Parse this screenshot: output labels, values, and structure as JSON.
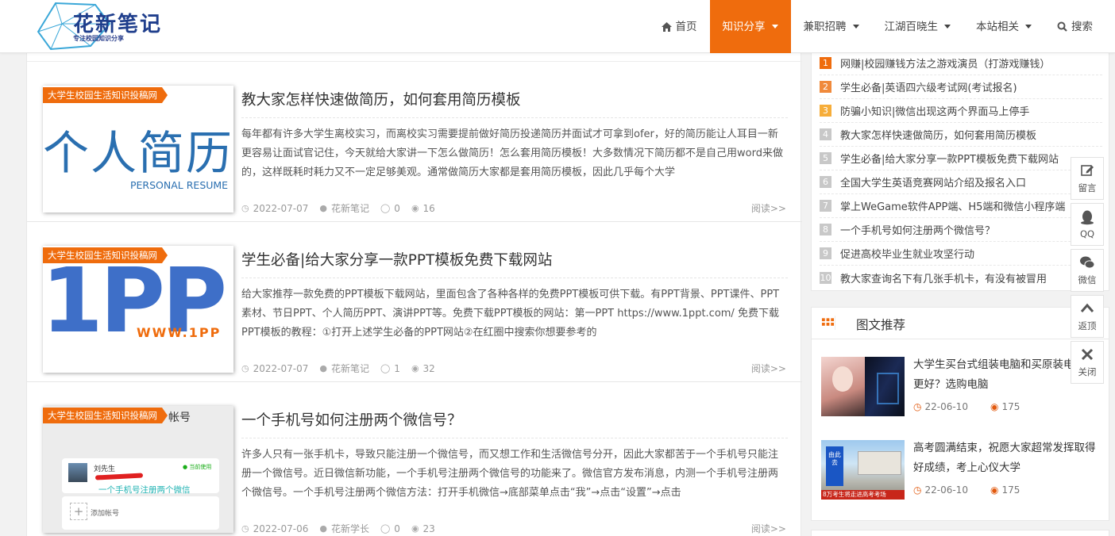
{
  "site": {
    "logo_title": "花新笔记",
    "logo_subtitle": "专注校园知识分享"
  },
  "nav": [
    {
      "label": "首页",
      "icon": "home-icon",
      "active": false,
      "dropdown": false
    },
    {
      "label": "知识分享",
      "icon": "",
      "active": true,
      "dropdown": true
    },
    {
      "label": "兼职招聘",
      "icon": "",
      "active": false,
      "dropdown": true
    },
    {
      "label": "江湖百晓生",
      "icon": "",
      "active": false,
      "dropdown": true
    },
    {
      "label": "本站相关",
      "icon": "",
      "active": false,
      "dropdown": true
    },
    {
      "label": "搜索",
      "icon": "search-icon",
      "active": false,
      "dropdown": false
    }
  ],
  "posts": [
    {
      "category_tag": "大学生校园生活知识投稿网",
      "title": "教大家怎样快速做简历，如何套用简历模板",
      "excerpt": "每年都有许多大学生离校实习，而离校实习需要提前做好简历投递简历并面试才可拿到ofer，好的简历能让人耳目一新更容易让面试官记住，今天就给大家讲一下怎么做简历！怎么套用简历模板！大多数情况下简历都不是自己用word来做的，这样既耗时耗力又不一定足够美观。通常做简历大家都是套用简历模板，因此几乎每个大学",
      "date": "2022-07-07",
      "author": "花新笔记",
      "comments": "0",
      "views": "16",
      "read_more": "阅读>>",
      "thumb_main": "个人简历",
      "thumb_sub": "PERSONAL RESUME"
    },
    {
      "category_tag": "大学生校园生活知识投稿网",
      "title": "学生必备|给大家分享一款PPT模板免费下载网站",
      "excerpt": "给大家推荐一款免费的PPT模板下载网站，里面包含了各种各样的免费PPT模板可供下载。有PPT背景、PPT课件、PPT素材、节日PPT、个人简历PPT、演讲PPT等。免费下载PPT模板的网站：第一PPT https://www.1ppt.com/ 免费下载PPT模板的教程：①打开上述学生必备的PPT网站②在红圈中搜索你想要参考的",
      "date": "2022-07-07",
      "author": "花新笔记",
      "comments": "1",
      "views": "32",
      "read_more": "阅读>>",
      "thumb_main": "1PP",
      "thumb_sub": "WWW.1PP"
    },
    {
      "category_tag": "大学生校园生活知识投稿网",
      "title": "一个手机号如何注册两个微信号？",
      "excerpt": "许多人只有一张手机卡，导致只能注册一个微信号，而又想工作和生活微信号分开，因此大家都苦于一个手机号只能注册一个微信号。近日微信新功能，一个手机号注册两个微信号的功能来了。微信官方发布消息，内测一个手机号注册两个微信号。一个手机号注册两个微信方法：打开手机微信→底部菜单点击“我”→点击“设置”→点击",
      "date": "2022-07-06",
      "author": "花新学长",
      "comments": "0",
      "views": "23",
      "read_more": "阅读>>",
      "thumb_header": "帐号",
      "thumb_user": "刘先生",
      "thumb_current": "当前使用",
      "thumb_caption": "一个手机号注册两个微信",
      "thumb_add": "添加帐号"
    }
  ],
  "ranking": [
    {
      "num": "1",
      "title": "网赚|校园赚钱方法之游戏演员（打游戏赚钱）",
      "color": "#ef6c0d"
    },
    {
      "num": "2",
      "title": "学生必备|英语四六级考试网(考试报名)",
      "color": "#f08a3c"
    },
    {
      "num": "3",
      "title": "防骗小知识|微信出现这两个界面马上停手",
      "color": "#f6ad3a"
    },
    {
      "num": "4",
      "title": "教大家怎样快速做简历，如何套用简历模板",
      "color": "#c8c8c8"
    },
    {
      "num": "5",
      "title": "学生必备|给大家分享一款PPT模板免费下载网站",
      "color": "#c8c8c8"
    },
    {
      "num": "6",
      "title": "全国大学生英语竞赛网站介绍及报名入口",
      "color": "#c8c8c8"
    },
    {
      "num": "7",
      "title": "掌上WeGame软件APP端、H5端和微信小程序端",
      "color": "#c8c8c8"
    },
    {
      "num": "8",
      "title": "一个手机号如何注册两个微信号？",
      "color": "#c8c8c8"
    },
    {
      "num": "9",
      "title": "促进高校毕业生就业攻坚行动",
      "color": "#c8c8c8"
    },
    {
      "num": "10",
      "title": "教大家查询名下有几张手机卡，有没有被冒用",
      "color": "#c8c8c8"
    }
  ],
  "recommend": {
    "title": "图文推荐",
    "items": [
      {
        "title": "大学生买台式组装电脑和买原装电脑谁更好？选购电脑",
        "date": "22-06-10",
        "views": "175"
      },
      {
        "title": "高考圆满结束，祝愿大家超常发挥取得好成绩，考上心仪大学",
        "date": "22-06-10",
        "views": "175",
        "img_caption": "8万考生将走进高考考场",
        "img_sign": "由此去"
      }
    ]
  },
  "float_bar": [
    {
      "label": "留言",
      "icon": "edit-icon"
    },
    {
      "label": "QQ",
      "icon": "qq-icon"
    },
    {
      "label": "微信",
      "icon": "wechat-icon"
    },
    {
      "label": "返顶",
      "icon": "chevron-up-icon"
    },
    {
      "label": "关闭",
      "icon": "close-icon"
    }
  ],
  "colors": {
    "accent": "#ef6c0d",
    "brand": "#1f3e8c"
  }
}
